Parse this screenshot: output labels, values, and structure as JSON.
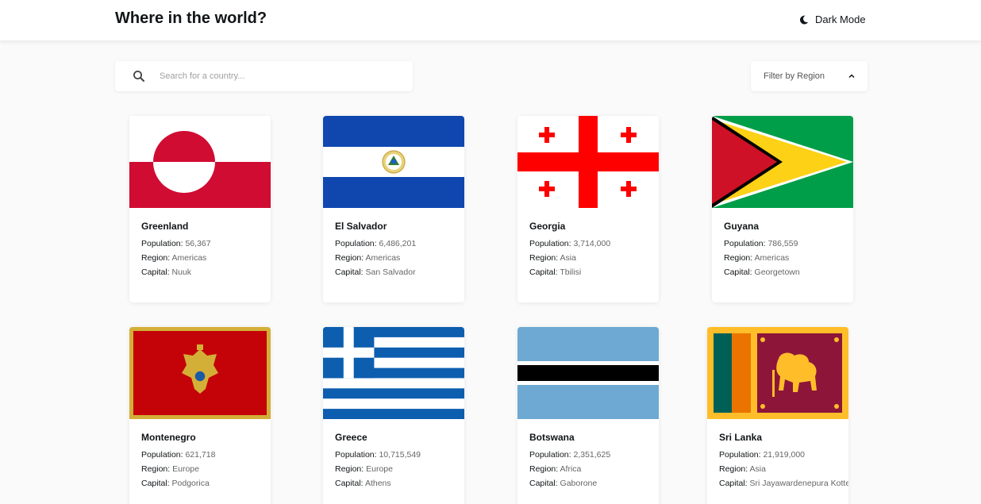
{
  "header": {
    "title": "Where in the world?",
    "dark_mode_label": "Dark Mode",
    "dark_mode_icon": "moon-icon"
  },
  "search": {
    "placeholder": "Search for a country...",
    "value": "",
    "icon": "search-icon"
  },
  "filter": {
    "label": "Filter by Region",
    "icon": "chevron-up-icon"
  },
  "labels": {
    "population": "Population: ",
    "region": "Region: ",
    "capital": "Capital: "
  },
  "countries": [
    {
      "name": "Greenland",
      "population": "56,367",
      "region": "Americas",
      "capital": "Nuuk"
    },
    {
      "name": "El Salvador",
      "population": "6,486,201",
      "region": "Americas",
      "capital": "San Salvador"
    },
    {
      "name": "Georgia",
      "population": "3,714,000",
      "region": "Asia",
      "capital": "Tbilisi"
    },
    {
      "name": "Guyana",
      "population": "786,559",
      "region": "Americas",
      "capital": "Georgetown"
    },
    {
      "name": "Montenegro",
      "population": "621,718",
      "region": "Europe",
      "capital": "Podgorica"
    },
    {
      "name": "Greece",
      "population": "10,715,549",
      "region": "Europe",
      "capital": "Athens"
    },
    {
      "name": "Botswana",
      "population": "2,351,625",
      "region": "Africa",
      "capital": "Gaborone"
    },
    {
      "name": "Sri Lanka",
      "population": "21,919,000",
      "region": "Asia",
      "capital": "Sri Jayawardenepura Kotte"
    }
  ],
  "colors": {
    "background": "#fafafa",
    "text": "#111517",
    "muted_value": "#666666"
  }
}
